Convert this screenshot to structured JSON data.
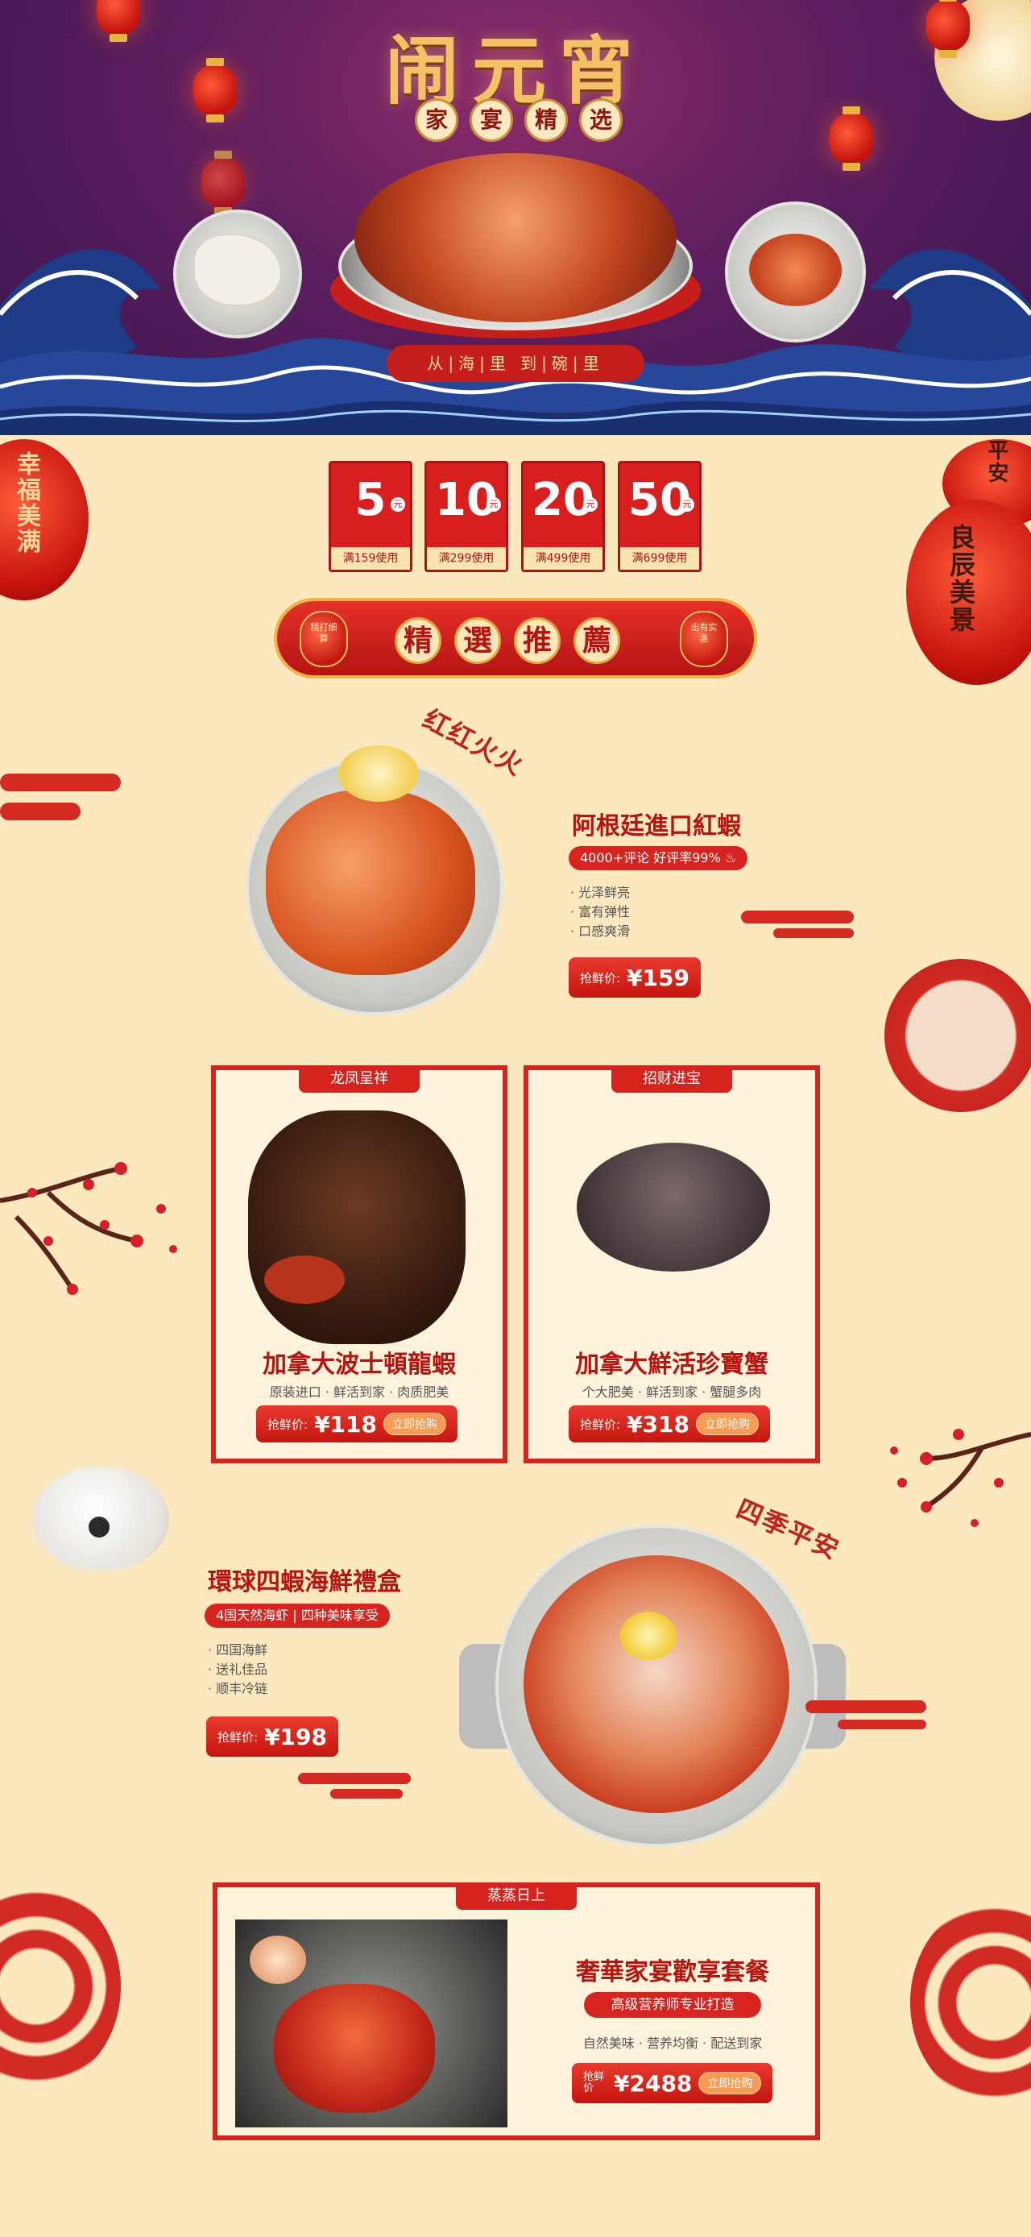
{
  "banner": {
    "title": "闹元宵",
    "subtitle_chars": [
      "家",
      "宴",
      "精",
      "选"
    ],
    "tagline": "从|海|里   到|碗|里"
  },
  "coupons": [
    {
      "amount": "5",
      "unit": "元",
      "condition": "满159使用"
    },
    {
      "amount": "10",
      "unit": "元",
      "condition": "满299使用"
    },
    {
      "amount": "20",
      "unit": "元",
      "condition": "满499使用"
    },
    {
      "amount": "50",
      "unit": "元",
      "condition": "满699使用"
    }
  ],
  "section": {
    "title_chars": [
      "精",
      "選",
      "推",
      "薦"
    ],
    "left_lantern": "精打细算",
    "right_lantern": "出有实惠"
  },
  "side_lanterns": {
    "left": "幸福美满",
    "right_top": "平安",
    "right": "良辰美景"
  },
  "product1": {
    "badge": "红红火火",
    "title": "阿根廷進口紅蝦",
    "pill": "4000+评论  好评率99% ♨",
    "features": [
      "· 光泽鲜亮",
      "· 富有弹性",
      "· 口感爽滑"
    ],
    "price_label": "抢鲜价:",
    "price": "¥159"
  },
  "card_lobster": {
    "caption": "龙凤呈祥",
    "title": "加拿大波士頓龍蝦",
    "desc": "原装进口 · 鲜活到家 · 肉质肥美",
    "price_label": "抢鲜价:",
    "price": "¥118",
    "buy": "立即抢购"
  },
  "card_crab": {
    "caption": "招财进宝",
    "title": "加拿大鮮活珍寶蟹",
    "desc": "个大肥美 · 鲜活到家 · 蟹腿多肉",
    "price_label": "抢鲜价:",
    "price": "¥318",
    "buy": "立即抢购"
  },
  "product4": {
    "badge": "四季平安",
    "title": "環球四蝦海鮮禮盒",
    "pill": "4国天然海虾 | 四种美味享受",
    "features": [
      "· 四国海鲜",
      "· 送礼佳品",
      "· 顺丰冷链"
    ],
    "price_label": "抢鲜价:",
    "price": "¥198"
  },
  "card_feast": {
    "caption": "蒸蒸日上",
    "title": "奢華家宴歡享套餐",
    "pill": "高级营养师专业打造",
    "desc": "自然美味 · 营养均衡 · 配送到家",
    "price_label": "抢鲜价",
    "price": "¥2488",
    "buy": "立即抢购"
  },
  "colors": {
    "brand_red": "#d7231d",
    "cream": "#fce8bf",
    "gold": "#f0b34a",
    "night_purple": "#5c1e5e"
  }
}
